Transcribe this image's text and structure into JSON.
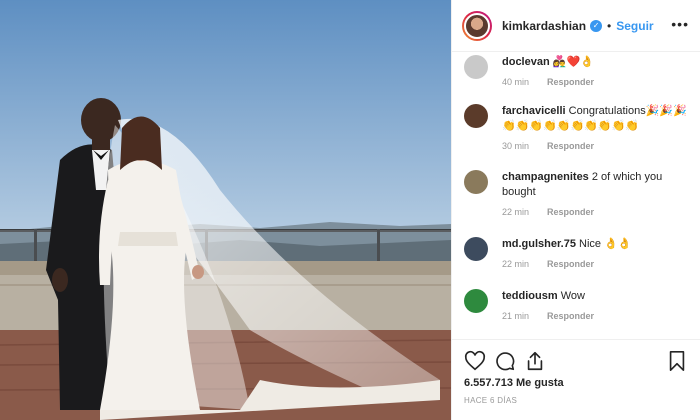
{
  "header": {
    "username": "kimkardashian",
    "separator": "•",
    "follow_label": "Seguir",
    "more_label": "•••"
  },
  "comments": [
    {
      "user": "doclevan",
      "text": "👩‍❤️‍👨❤️👌",
      "time": "40 min",
      "reply": "Responder",
      "avatar_color": "#c9c9c9"
    },
    {
      "user": "farchavicelli",
      "text": "Congratulations🎉🎉🎉 👏👏👏👏👏👏👏👏👏👏",
      "time": "30 min",
      "reply": "Responder",
      "avatar_color": "#5b3b2a"
    },
    {
      "user": "champagnenites",
      "text": "2 of which you bought",
      "time": "22 min",
      "reply": "Responder",
      "avatar_color": "#8a7a5c"
    },
    {
      "user": "md.gulsher.75",
      "text": "Nice 👌👌",
      "time": "22 min",
      "reply": "Responder",
      "avatar_color": "#3d4b5e"
    },
    {
      "user": "teddiousm",
      "text": "Wow",
      "time": "21 min",
      "reply": "Responder",
      "avatar_color": "#2e8a3e"
    }
  ],
  "footer": {
    "likes": "6.557.713 Me gusta",
    "date": "HACE 6 DÍAS"
  },
  "colors": {
    "accent": "#3897f0",
    "text": "#262626",
    "muted": "#999999",
    "border": "#efefef"
  }
}
